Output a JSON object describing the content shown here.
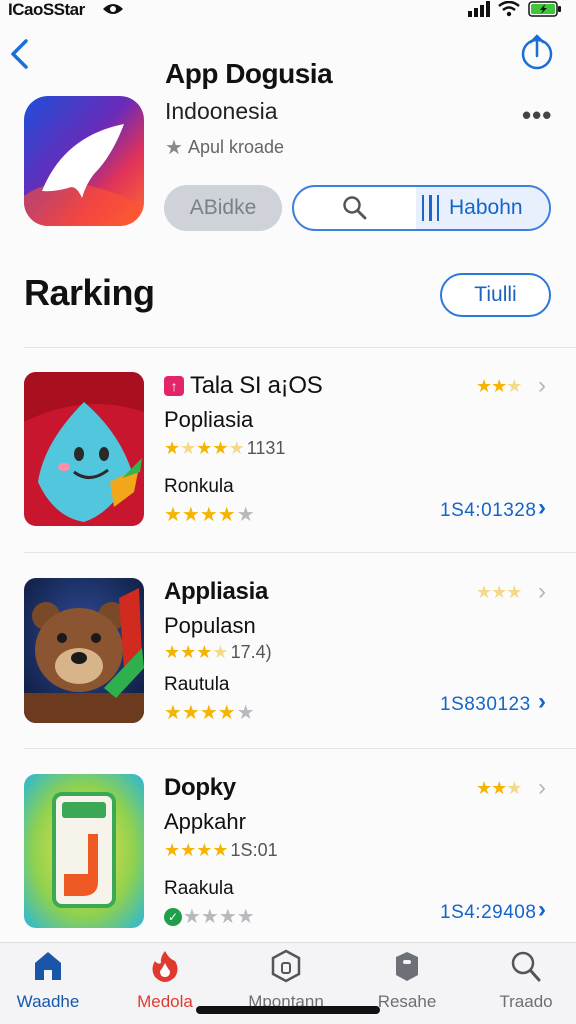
{
  "status_bar": {
    "carrier": "ICaoSStar"
  },
  "app": {
    "title": "App Dogusia",
    "subtitle": "Indoonesia",
    "meta": "Apul kroade",
    "primary_button": "ABidke",
    "secondary_button": "Habohn"
  },
  "section": {
    "title": "Rarking",
    "button": "Tiulli"
  },
  "rows": [
    {
      "name": "Tala SI a¡OS",
      "subtitle": "Popliasia",
      "rating_count": "1131",
      "label": "Ronkula",
      "count": "1S4:01328",
      "stars": 4,
      "mini_stars": 2.5,
      "icon_color": "#d81b34"
    },
    {
      "name": "Appliasia",
      "subtitle": "Populasn",
      "rating_count": "17.4)",
      "label": "Rautula",
      "count": "1S830123",
      "stars": 4,
      "mini_stars": 0,
      "icon_color": "#6b3a1f"
    },
    {
      "name": "Dopky",
      "subtitle": "Appkahr",
      "rating_count": "1S:01",
      "label": "Raakula",
      "count": "1S4:29408",
      "stars": 1,
      "mini_stars": 2,
      "icon_color": "#f08a2a"
    }
  ],
  "tabs": [
    {
      "label": "Waadhe",
      "icon": "home-icon"
    },
    {
      "label": "Medola",
      "icon": "flame-icon"
    },
    {
      "label": "Mpontann",
      "icon": "hexagon-icon"
    },
    {
      "label": "Resahe",
      "icon": "bag-icon"
    },
    {
      "label": "Traado",
      "icon": "search-icon"
    }
  ],
  "colors": {
    "accent": "#1565c8",
    "star": "#f4b400",
    "tab_active": "#e03a2f",
    "tab_home": "#1a56a8"
  }
}
